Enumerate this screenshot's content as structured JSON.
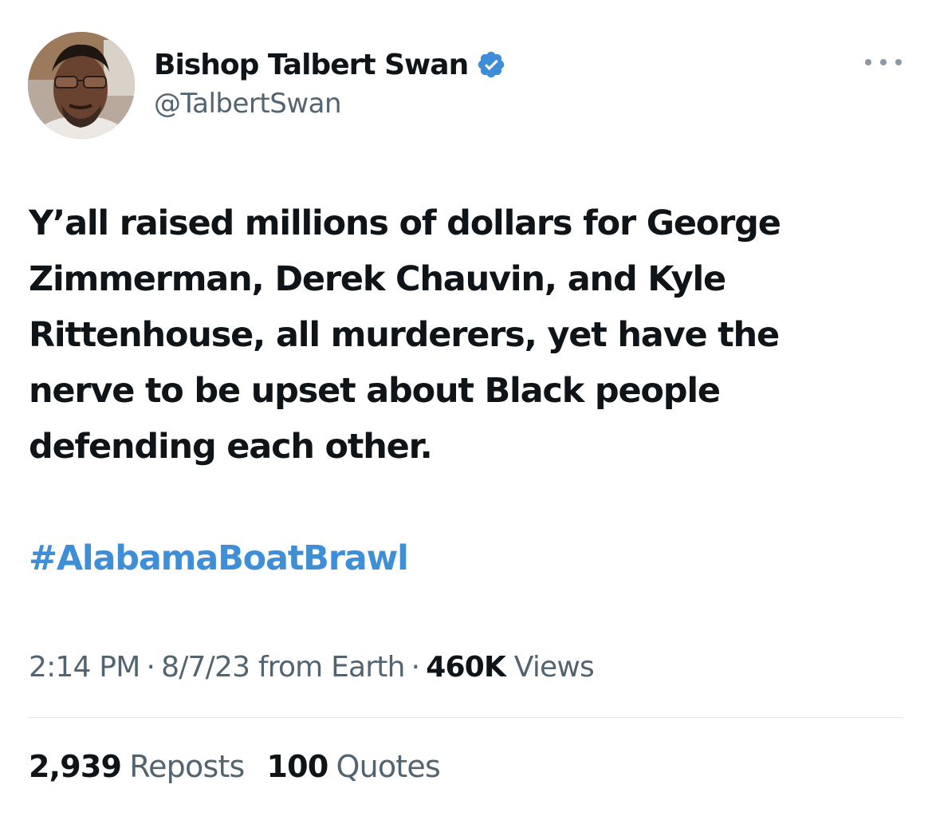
{
  "author": {
    "display_name": "Bishop Talbert Swan",
    "handle": "@TalbertSwan",
    "verified": true
  },
  "icons": {
    "verified": "verified-badge-icon",
    "more": "more-options-icon",
    "avatar": "avatar-photo"
  },
  "tweet": {
    "text": "Y’all raised millions of dollars for George Zimmerman, Derek Chauvin, and Kyle Rittenhouse, all murderers, yet have the nerve to be upset about Black people defending each other.",
    "hashtag": "#AlabamaBoatBrawl"
  },
  "meta": {
    "time": "2:14 PM",
    "separator": "·",
    "date": "8/7/23",
    "source_prefix": "from",
    "source": "Earth",
    "views_count": "460K",
    "views_label": "Views"
  },
  "stats": {
    "reposts_count": "2,939",
    "reposts_label": "Reposts",
    "quotes_count": "100",
    "quotes_label": "Quotes"
  },
  "colors": {
    "text_primary": "#0f1419",
    "text_secondary": "#536471",
    "link": "#3f8fd8",
    "verified_badge": "#3e8ddb",
    "divider": "#dfe3e6"
  }
}
